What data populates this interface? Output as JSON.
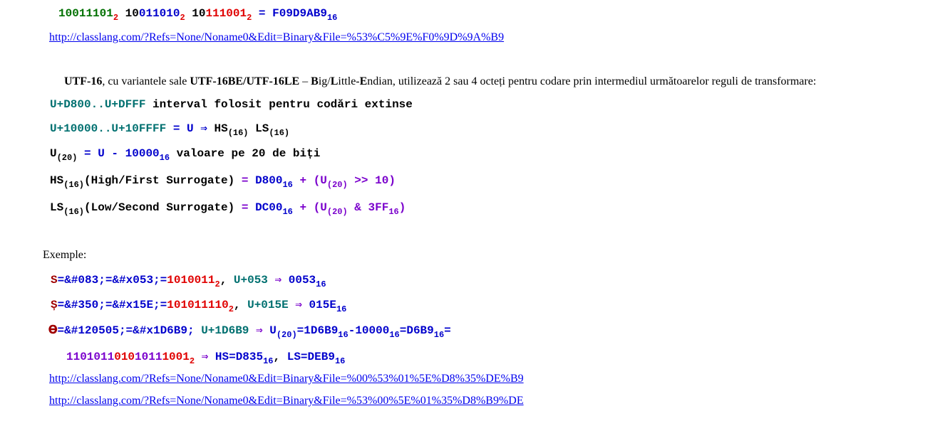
{
  "top": {
    "b1a": "1",
    "b1b": "0",
    "b1c": "0",
    "b1d": "1",
    "b1e": "1101",
    "b2a": "10",
    "b2b": "011010",
    "b3a": "10",
    "b3b": "111001",
    "base2": "2",
    "eq": "=",
    "hex": "F09D9AB9",
    "base16": "16",
    "link": "http://classlang.com/?Refs=None/Noname0&Edit=Binary&File=%53%C5%9E%F0%9D%9A%B9"
  },
  "utf16": {
    "name": "UTF-16",
    "t1": ", cu variantele sale ",
    "variants": "UTF-16BE/UTF-16LE",
    "t2": " – ",
    "big_b": "B",
    "big_rest": "ig/",
    "little_l": "L",
    "little_rest": "ittle-",
    "endian_e": "E",
    "endian_rest": "ndian",
    "t3": ", utilizează 2 sau 4 octeți pentru codare prin intermediul următoarelor reguli de transformare:"
  },
  "rules": {
    "r1_range": "U+D800..U+DFFF",
    "r1_text": " interval folosit pentru codări extinse",
    "r2_range": "U+10000..U+10FFFF",
    "r2_eq": " = U ",
    "r2_arrow": "⇒",
    "r2_hs": " HS",
    "r2_hs_sub": "(16)",
    "r2_ls": " LS",
    "r2_ls_sub": "(16)",
    "r3_u": "U",
    "r3_u_sub": "(20)",
    "r3_eq": " = U - ",
    "r3_val": "10000",
    "r3_val_sub": "16",
    "r3_text": " valoare pe 20 de biți",
    "r4_hs": "HS",
    "r4_hs_sub": "(16)",
    "r4_text": "(High/First Surrogate)",
    "r4_eq": " = ",
    "r4_val": "D800",
    "r4_val_sub": "16",
    "r4_plus": " + ",
    "r4_u": "(U",
    "r4_u_sub": "(20)",
    "r4_op": " >> 10)",
    "r5_ls": "LS",
    "r5_ls_sub": "(16)",
    "r5_text": "(Low/Second Surrogate)",
    "r5_eq": " = ",
    "r5_val": "DC00",
    "r5_val_sub": "16",
    "r5_plus": " + ",
    "r5_u": "(U",
    "r5_u_sub": "(20)",
    "r5_op": " & 3FF",
    "r5_op_sub": "16",
    "r5_close": ")"
  },
  "examples": {
    "label": "Exemple:",
    "e1_char": "S",
    "e1_eq1": "=",
    "e1_dec": "&#083;",
    "e1_eq2": "=",
    "e1_hexent": "&#x053;",
    "e1_eq3": "=",
    "e1_bin": "1010011",
    "e1_bin_sub": "2",
    "e1_comma": ", ",
    "e1_cp": "U+053",
    "e1_arrow": " ⇒ ",
    "e1_res": "0053",
    "e1_res_sub": "16",
    "e2_char": "Ș",
    "e2_eq1": "=",
    "e2_dec": "&#350;",
    "e2_eq2": "=",
    "e2_hexent": "&#x15E;",
    "e2_eq3": "=",
    "e2_bin": "101011110",
    "e2_bin_sub": "2",
    "e2_comma": ", ",
    "e2_cp": "U+015E",
    "e2_arrow": " ⇒ ",
    "e2_res": "015E",
    "e2_res_sub": "16",
    "e3_char": "𝚹",
    "e3_eq1": "=",
    "e3_dec": "&#120505;",
    "e3_eq2": "=",
    "e3_hexent": "&#x1D6B9;",
    "e3_sep": " ",
    "e3_cp": "U+1D6B9",
    "e3_arrow": " ⇒ ",
    "e3_u": "U",
    "e3_u_sub": "(20)",
    "e3_eq": "=",
    "e3_v1": "1D6B9",
    "e3_v1_sub": "16",
    "e3_minus": "-",
    "e3_v2": "10000",
    "e3_v2_sub": "16",
    "e3_eq_b": "=",
    "e3_v3": "D6B9",
    "e3_v3_sub": "16",
    "e3_eq_c": "=",
    "e4_b1": "1101011",
    "e4_b2": "010",
    "e4_b3": "1011",
    "e4_b4": "1001",
    "e4_sub": "2",
    "e4_arrow": " ⇒ ",
    "e4_hs": "HS=D835",
    "e4_hs_sub": "16",
    "e4_comma": ", ",
    "e4_ls": "LS=DEB9",
    "e4_ls_sub": "16",
    "link1": "http://classlang.com/?Refs=None/Noname0&Edit=Binary&File=%00%53%01%5E%D8%35%DE%B9",
    "link2": "http://classlang.com/?Refs=None/Noname0&Edit=Binary&File=%53%00%5E%01%35%D8%B9%DE"
  },
  "colors": {
    "link": "#0000ee",
    "teal": "#007070",
    "blue": "#0000cc",
    "purple": "#7a00cc",
    "red": "#e00000"
  }
}
